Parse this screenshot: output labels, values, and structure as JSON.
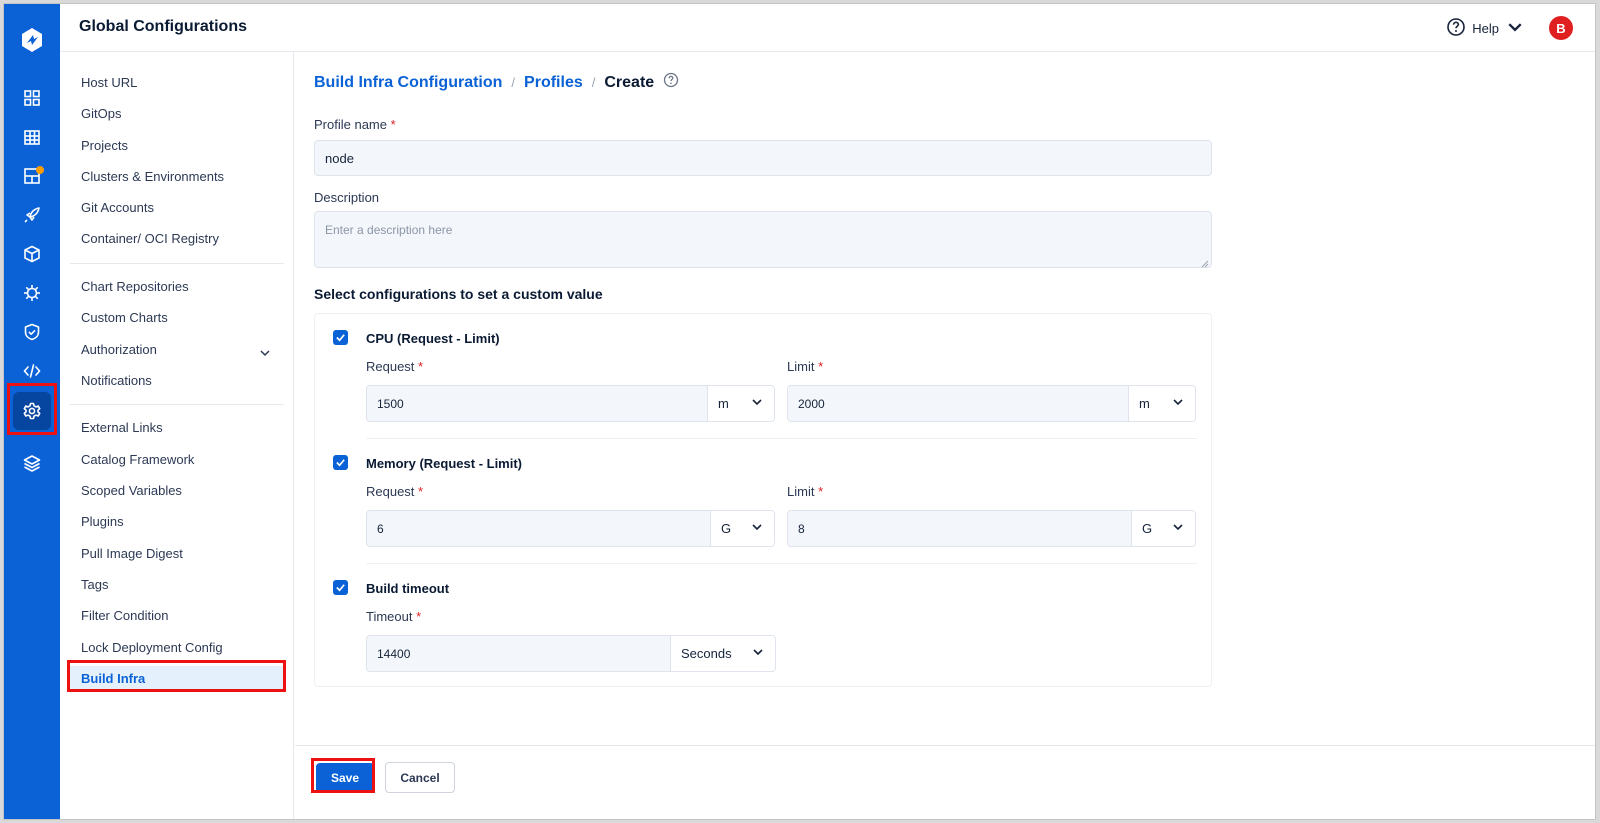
{
  "header": {
    "title": "Global Configurations",
    "help_label": "Help",
    "avatar_initial": "B"
  },
  "rail": {
    "icons": [
      "app-logo-icon",
      "overview-grid-icon",
      "app-list-icon",
      "resource-browser-icon",
      "rocket-icon",
      "cube-icon",
      "helm-icon",
      "security-shield-icon",
      "code-icon",
      "settings-gear-icon",
      "stack-layers-icon"
    ],
    "active": "settings-gear-icon",
    "notification_color": "#ff9d00"
  },
  "settings_nav": {
    "groups": [
      [
        "Host URL",
        "GitOps",
        "Projects",
        "Clusters & Environments",
        "Git Accounts",
        "Container/ OCI Registry"
      ],
      [
        "Chart Repositories",
        "Custom Charts",
        "Authorization",
        "Notifications"
      ],
      [
        "External Links",
        "Catalog Framework",
        "Scoped Variables",
        "Plugins",
        "Pull Image Digest",
        "Tags",
        "Filter Condition",
        "Lock Deployment Config",
        "Build Infra"
      ]
    ],
    "active_item": "Build Infra"
  },
  "breadcrumb": {
    "root": "Build Infra Configuration",
    "parent": "Profiles",
    "current": "Create",
    "separator": "/"
  },
  "form": {
    "profile_name_label": "Profile name",
    "profile_name_value": "node",
    "description_label": "Description",
    "description_placeholder": "Enter a description here",
    "section_title": "Select configurations to set a custom value",
    "required_mark": "*",
    "cpu": {
      "title": "CPU (Request - Limit)",
      "checked": true,
      "request_label": "Request",
      "request_value": "1500",
      "request_unit": "m",
      "limit_label": "Limit",
      "limit_value": "2000",
      "limit_unit": "m"
    },
    "memory": {
      "title": "Memory (Request - Limit)",
      "checked": true,
      "request_label": "Request",
      "request_value": "6",
      "request_unit": "G",
      "limit_label": "Limit",
      "limit_value": "8",
      "limit_unit": "G"
    },
    "timeout": {
      "title": "Build timeout",
      "checked": true,
      "label": "Timeout",
      "value": "14400",
      "unit": "Seconds"
    }
  },
  "footer": {
    "save_label": "Save",
    "cancel_label": "Cancel"
  },
  "colors": {
    "brand": "#0a62d6",
    "highlight": "#ee1111",
    "required": "#e02020"
  }
}
